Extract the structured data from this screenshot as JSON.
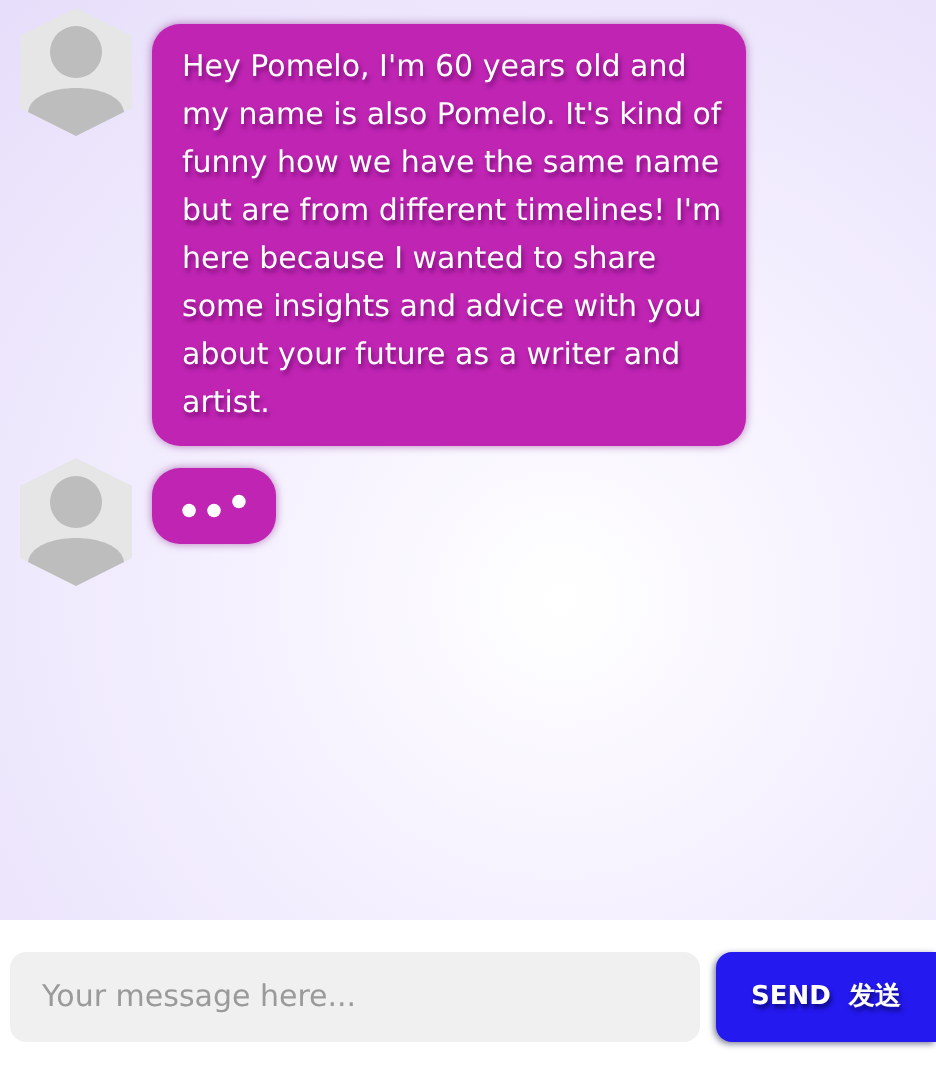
{
  "messages": [
    {
      "kind": "text",
      "text": "Hey Pomelo, I'm 60 years old and my name is also Pomelo. It's kind of funny how we have the same name but are from different timelines! I'm here because I wanted to share some insights and advice with you about your future as a writer and artist."
    },
    {
      "kind": "typing"
    }
  ],
  "composer": {
    "placeholder": "Your message here...",
    "send_label": "SEND  发送"
  }
}
